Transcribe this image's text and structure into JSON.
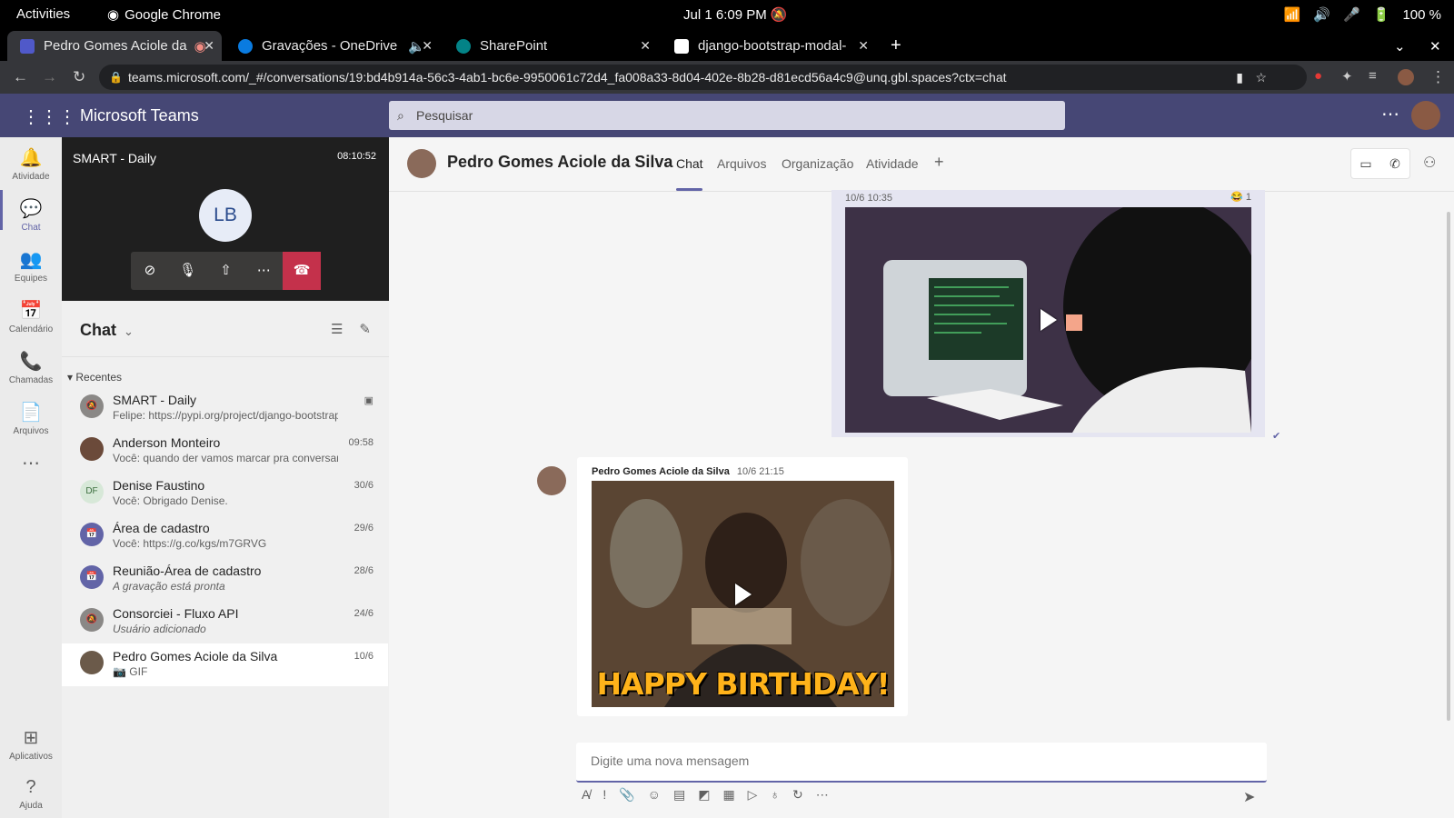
{
  "os": {
    "activities": "Activities",
    "app": "Google Chrome",
    "clock": "Jul 1  6:09 PM",
    "battery": "100 %"
  },
  "browser": {
    "tabs": [
      {
        "title": "Pedro Gomes Aciole da",
        "color": "#5059c9"
      },
      {
        "title": "Gravações - OneDrive",
        "color": "#0a7be0"
      },
      {
        "title": "SharePoint",
        "color": "#038387"
      },
      {
        "title": "django-bootstrap-modal-",
        "color": "#ffffff"
      }
    ],
    "url": "teams.microsoft.com/_#/conversations/19:bd4b914a-56c3-4ab1-bc6e-9950061c72d4_fa008a33-8d04-402e-8b28-d81ecd56a4c9@unq.gbl.spaces?ctx=chat"
  },
  "teams": {
    "brand": "Microsoft Teams",
    "search_placeholder": "Pesquisar"
  },
  "rail": [
    {
      "label": "Atividade",
      "icon": "bell-icon",
      "glyph": "🔔"
    },
    {
      "label": "Chat",
      "icon": "chat-icon",
      "glyph": "💬"
    },
    {
      "label": "Equipes",
      "icon": "teams-icon",
      "glyph": "👥"
    },
    {
      "label": "Calendário",
      "icon": "calendar-icon",
      "glyph": "📅"
    },
    {
      "label": "Chamadas",
      "icon": "phone-icon",
      "glyph": "📞"
    },
    {
      "label": "Arquivos",
      "icon": "file-icon",
      "glyph": "📄"
    },
    {
      "label": "Aplicativos",
      "icon": "apps-icon",
      "glyph": "⊞"
    },
    {
      "label": "Ajuda",
      "icon": "help-icon",
      "glyph": "?"
    }
  ],
  "call": {
    "title": "SMART - Daily",
    "duration": "08:10:52",
    "initials": "LB"
  },
  "chatlist": {
    "title": "Chat",
    "section": "Recentes",
    "items": [
      {
        "name": "SMART - Daily",
        "preview": "Felipe: https://pypi.org/project/django-bootstrap...",
        "date": "",
        "color": "#8a8886",
        "ini": "🔕"
      },
      {
        "name": "Anderson Monteiro",
        "preview": "Você: quando der vamos marcar pra conversar",
        "date": "09:58",
        "color": "#6b4a3a",
        "ini": ""
      },
      {
        "name": "Denise Faustino",
        "preview": "Você: Obrigado Denise.",
        "date": "30/6",
        "color": "#d7e8d8",
        "ini": "DF"
      },
      {
        "name": "Área de cadastro",
        "preview": "Você: https://g.co/kgs/m7GRVG",
        "date": "29/6",
        "color": "#6264a7",
        "ini": "📅"
      },
      {
        "name": "Reunião-Área de cadastro",
        "preview": "A gravação está pronta",
        "date": "28/6",
        "color": "#6264a7",
        "ini": "📅"
      },
      {
        "name": "Consorciei - Fluxo API",
        "preview": "Usuário adicionado",
        "date": "24/6",
        "color": "#8a8886",
        "ini": "🔕"
      },
      {
        "name": "Pedro Gomes Aciole da Silva",
        "preview": "📷 GIF",
        "date": "10/6",
        "color": "#6b5a4a",
        "ini": ""
      }
    ]
  },
  "conversation": {
    "name": "Pedro Gomes Aciole da Silva",
    "tabs": [
      "Chat",
      "Arquivos",
      "Organização",
      "Atividade"
    ],
    "msg1": {
      "time": "10/6 10:35",
      "reaction": "😂 1"
    },
    "msg2": {
      "author": "Pedro Gomes Aciole da Silva",
      "time": "10/6 21:15",
      "gif_text": "HAPPY BIRTHDAY!"
    },
    "compose_placeholder": "Digite uma nova mensagem"
  }
}
